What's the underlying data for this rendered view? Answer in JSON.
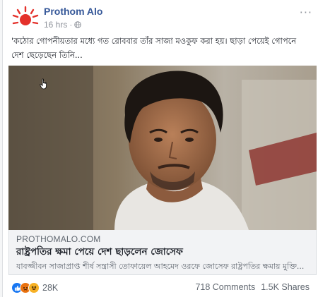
{
  "post": {
    "page_name": "Prothom Alo",
    "time": "16 hrs",
    "text": "'কঠোর গোপনীয়তার মধ্যে গত রোববার তাঁর সাজা মওকুফ করা হয়। ছাড়া পেয়েই গোপনে দেশ ছেড়েছেন তিনি..."
  },
  "link": {
    "domain": "PROTHOMALO.COM",
    "title": "রাষ্ট্রপতির ক্ষমা পেয়ে দেশ ছাড়লেন জোসেফ",
    "description": "যাবজ্জীবন সাজাপ্রাপ্ত শীর্ষ সন্ত্রাসী তোফায়েল আহমেদ ওরফে জোসেফ রাষ্ট্রপতির ক্ষমায় মুক্তি..."
  },
  "footer": {
    "reaction_count": "28K",
    "comments": "718 Comments",
    "shares": "1.5K Shares"
  },
  "icons": {
    "logo": "prothom-alo-sun-logo",
    "privacy": "globe-icon",
    "more": "more-options-icon",
    "reactions": [
      "like-icon",
      "angry-icon",
      "haha-icon"
    ]
  },
  "colors": {
    "brand_red": "#e4312b",
    "link_blue": "#365899",
    "like_blue": "#1877f2",
    "reaction_yellow": "#f7b125"
  }
}
